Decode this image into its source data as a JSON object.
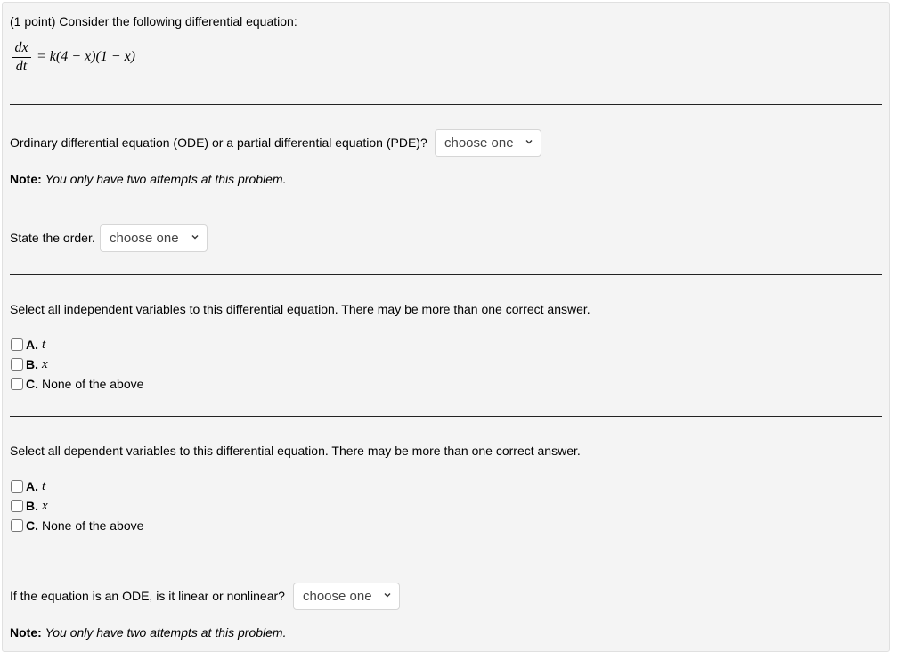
{
  "problem": {
    "header": "(1 point) Consider the following differential equation:",
    "equation": {
      "numerator": "dx",
      "denominator": "dt",
      "rhs": "= k(4 − x)(1 − x)"
    }
  },
  "q1": {
    "prompt": "Ordinary differential equation (ODE) or a partial differential equation (PDE)?",
    "select_value": "choose one",
    "note_label": "Note:",
    "note_text": "You only have two attempts at this problem."
  },
  "q2": {
    "prompt": "State the order.",
    "select_value": "choose one"
  },
  "q3": {
    "prompt": "Select all independent variables to this differential equation. There may be more than one correct answer.",
    "options": [
      {
        "label": "A.",
        "text": "t",
        "math": true,
        "checked": false
      },
      {
        "label": "B.",
        "text": "x",
        "math": true,
        "checked": false
      },
      {
        "label": "C.",
        "text": "None of the above",
        "math": false,
        "checked": false
      }
    ]
  },
  "q4": {
    "prompt": "Select all dependent variables to this differential equation. There may be more than one correct answer.",
    "options": [
      {
        "label": "A.",
        "text": "t",
        "math": true,
        "checked": false
      },
      {
        "label": "B.",
        "text": "x",
        "math": true,
        "checked": false
      },
      {
        "label": "C.",
        "text": "None of the above",
        "math": false,
        "checked": false
      }
    ]
  },
  "q5": {
    "prompt": "If the equation is an ODE, is it linear or nonlinear?",
    "select_value": "choose one",
    "note_label": "Note:",
    "note_text": "You only have two attempts at this problem."
  },
  "icons": {
    "dropdown": "chevron-down-icon",
    "checkbox": "checkbox-unchecked-icon"
  },
  "colors": {
    "panel_bg": "#f4f4f4",
    "panel_border": "#e0e0e0",
    "select_text": "#444444",
    "rule": "#222222"
  }
}
